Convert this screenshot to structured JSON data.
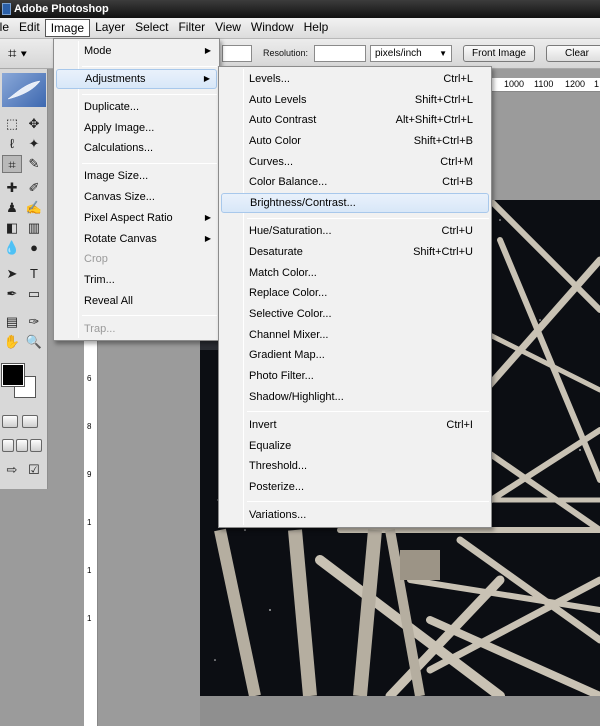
{
  "titlebar": {
    "title": "Adobe Photoshop"
  },
  "menubar": {
    "items": [
      {
        "label": "ile"
      },
      {
        "label": "Edit"
      },
      {
        "label": "Image"
      },
      {
        "label": "Layer"
      },
      {
        "label": "Select"
      },
      {
        "label": "Filter"
      },
      {
        "label": "View"
      },
      {
        "label": "Window"
      },
      {
        "label": "Help"
      }
    ],
    "active_index": 2
  },
  "options_bar": {
    "resolution_label": "Resolution:",
    "units_value": "pixels/inch",
    "front_image_button": "Front Image",
    "clear_button": "Clear"
  },
  "ruler_top": {
    "ticks": [
      "1000",
      "1100",
      "1200",
      "1"
    ]
  },
  "ruler_left": {
    "ticks": [
      "6",
      "8",
      "9",
      "1",
      "1",
      "1"
    ]
  },
  "image_menu": {
    "items": [
      {
        "label": "Mode",
        "submenu": true
      },
      {
        "label": "Adjustments",
        "submenu": true,
        "highlighted": true
      },
      {
        "label": "Duplicate..."
      },
      {
        "label": "Apply Image..."
      },
      {
        "label": "Calculations..."
      },
      {
        "label": "Image Size..."
      },
      {
        "label": "Canvas Size..."
      },
      {
        "label": "Pixel Aspect Ratio",
        "submenu": true
      },
      {
        "label": "Rotate Canvas",
        "submenu": true
      },
      {
        "label": "Crop",
        "disabled": true
      },
      {
        "label": "Trim..."
      },
      {
        "label": "Reveal All"
      },
      {
        "label": "Trap...",
        "disabled": true
      }
    ]
  },
  "adjustments_menu": {
    "items": [
      {
        "label": "Levels...",
        "shortcut": "Ctrl+L"
      },
      {
        "label": "Auto Levels",
        "shortcut": "Shift+Ctrl+L"
      },
      {
        "label": "Auto Contrast",
        "shortcut": "Alt+Shift+Ctrl+L"
      },
      {
        "label": "Auto Color",
        "shortcut": "Shift+Ctrl+B"
      },
      {
        "label": "Curves...",
        "shortcut": "Ctrl+M"
      },
      {
        "label": "Color Balance...",
        "shortcut": "Ctrl+B"
      },
      {
        "label": "Brightness/Contrast...",
        "shortcut": "",
        "highlighted": true
      },
      {
        "label": "Hue/Saturation...",
        "shortcut": "Ctrl+U"
      },
      {
        "label": "Desaturate",
        "shortcut": "Shift+Ctrl+U"
      },
      {
        "label": "Match Color...",
        "shortcut": ""
      },
      {
        "label": "Replace Color...",
        "shortcut": ""
      },
      {
        "label": "Selective Color...",
        "shortcut": ""
      },
      {
        "label": "Channel Mixer...",
        "shortcut": ""
      },
      {
        "label": "Gradient Map...",
        "shortcut": ""
      },
      {
        "label": "Photo Filter...",
        "shortcut": ""
      },
      {
        "label": "Shadow/Highlight...",
        "shortcut": ""
      },
      {
        "label": "Invert",
        "shortcut": "Ctrl+I"
      },
      {
        "label": "Equalize",
        "shortcut": ""
      },
      {
        "label": "Threshold...",
        "shortcut": ""
      },
      {
        "label": "Posterize...",
        "shortcut": ""
      },
      {
        "label": "Variations...",
        "shortcut": ""
      }
    ]
  },
  "colors": {
    "menu_bg": "#f1f1f1",
    "highlight_bg": "#dce9f8",
    "highlight_border": "#a8c8eb",
    "disabled_text": "#9a9a9a",
    "workspace": "#9b9b9b"
  }
}
